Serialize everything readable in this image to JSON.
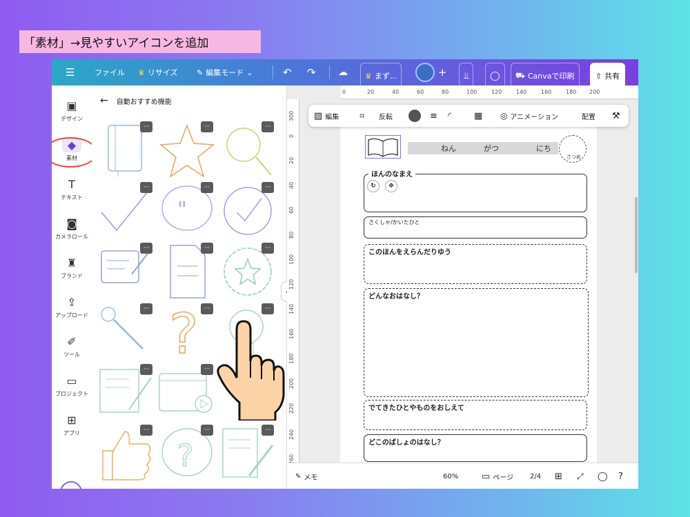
{
  "caption": "「素材」→見やすいアイコンを追加",
  "topbar": {
    "menu_icon": "hamburger-icon",
    "file": "ファイル",
    "resize": "リサイズ",
    "edit_mode": "編集モード",
    "title_btn": "まず...",
    "print": "Canvaで印刷",
    "share": "共有"
  },
  "rail": {
    "items": [
      {
        "label": "デザイン",
        "icon": "layout-icon"
      },
      {
        "label": "素材",
        "icon": "shapes-icon"
      },
      {
        "label": "テキスト",
        "icon": "text-icon"
      },
      {
        "label": "カメラロール",
        "icon": "camera-icon"
      },
      {
        "label": "ブランド",
        "icon": "brand-icon"
      },
      {
        "label": "アップロード",
        "icon": "upload-icon"
      },
      {
        "label": "ツール",
        "icon": "tool-icon"
      },
      {
        "label": "プロジェクト",
        "icon": "folder-icon"
      },
      {
        "label": "アプリ",
        "icon": "apps-icon"
      }
    ]
  },
  "panel": {
    "title": "自動おすすめ機能",
    "more_label": "···"
  },
  "ruler": {
    "h": [
      "0",
      "20",
      "40",
      "60",
      "80",
      "100",
      "120",
      "140",
      "160",
      "180",
      "200"
    ],
    "v": [
      "300",
      "0",
      "20",
      "40",
      "60",
      "80",
      "100",
      "120",
      "140",
      "160",
      "180",
      "200",
      "220",
      "240",
      "260"
    ]
  },
  "float_toolbar": {
    "edit": "編集",
    "flip": "反転",
    "animation": "アニメーション",
    "position": "配置"
  },
  "page": {
    "header": {
      "year": "ねん",
      "month": "がつ",
      "day": "にち",
      "stamp": "さつめ"
    },
    "sections": [
      {
        "label": "ほんのなまえ"
      },
      {
        "label": "さくしゃ/かいたひと"
      },
      {
        "label": "このほんをえらんだりゆう"
      },
      {
        "label": "どんなおはなし？"
      },
      {
        "label": "でてきたひとやものをおしえて"
      },
      {
        "label": "どこのばしょのはなし？"
      }
    ]
  },
  "bottombar": {
    "notes": "メモ",
    "zoom": "60%",
    "pages": "ページ",
    "page_count": "2/4"
  },
  "colors": {
    "accent": "#7b3fe0",
    "anno": "#e43333"
  }
}
